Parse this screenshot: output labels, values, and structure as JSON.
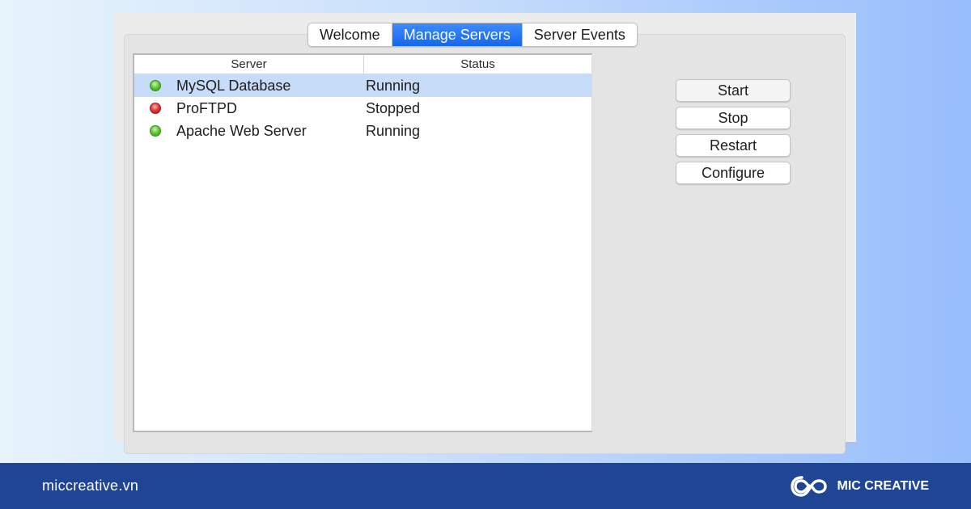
{
  "tabs": [
    {
      "label": "Welcome",
      "active": false
    },
    {
      "label": "Manage Servers",
      "active": true
    },
    {
      "label": "Server Events",
      "active": false
    }
  ],
  "table": {
    "columns": [
      "Server",
      "Status"
    ],
    "rows": [
      {
        "name": "MySQL Database",
        "status": "Running",
        "indicator": "green",
        "selected": true
      },
      {
        "name": "ProFTPD",
        "status": "Stopped",
        "indicator": "red",
        "selected": false
      },
      {
        "name": "Apache Web Server",
        "status": "Running",
        "indicator": "green",
        "selected": false
      }
    ]
  },
  "buttons": {
    "start": "Start",
    "stop": "Stop",
    "restart": "Restart",
    "configure": "Configure"
  },
  "footer": {
    "site": "miccreative.vn",
    "brand": "MIC CREATIVE",
    "brand_icon": "mic-creative-logo-icon"
  },
  "colors": {
    "tab_active": "#1467ee",
    "selected_row": "#c7dcf8",
    "running": "#66c93b",
    "stopped": "#e23b3b",
    "footer_bg": "#1f4594"
  }
}
